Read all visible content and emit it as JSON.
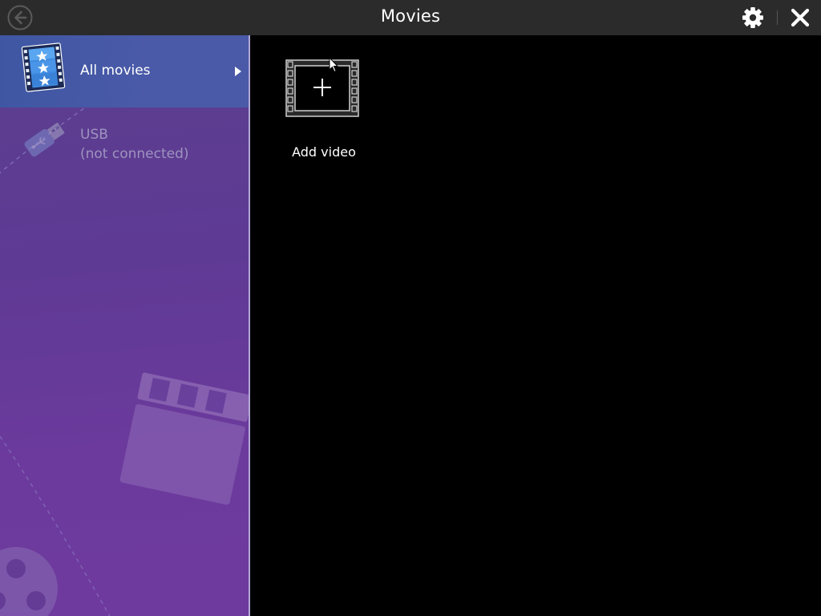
{
  "window": {
    "title": "Movies"
  },
  "sidebar": {
    "items": [
      {
        "label": "All movies",
        "icon": "film-icon",
        "selected": true
      },
      {
        "label": "USB",
        "sublabel": "(not connected)",
        "icon": "usb-icon",
        "selected": false
      }
    ]
  },
  "main": {
    "tiles": [
      {
        "label": "Add video",
        "icon": "add-video-icon"
      }
    ]
  },
  "colors": {
    "titlebar": "#2b2b2b",
    "sidebar": "#5f3a95",
    "selected_item": "#4a5aa8",
    "main_background": "#000000"
  }
}
